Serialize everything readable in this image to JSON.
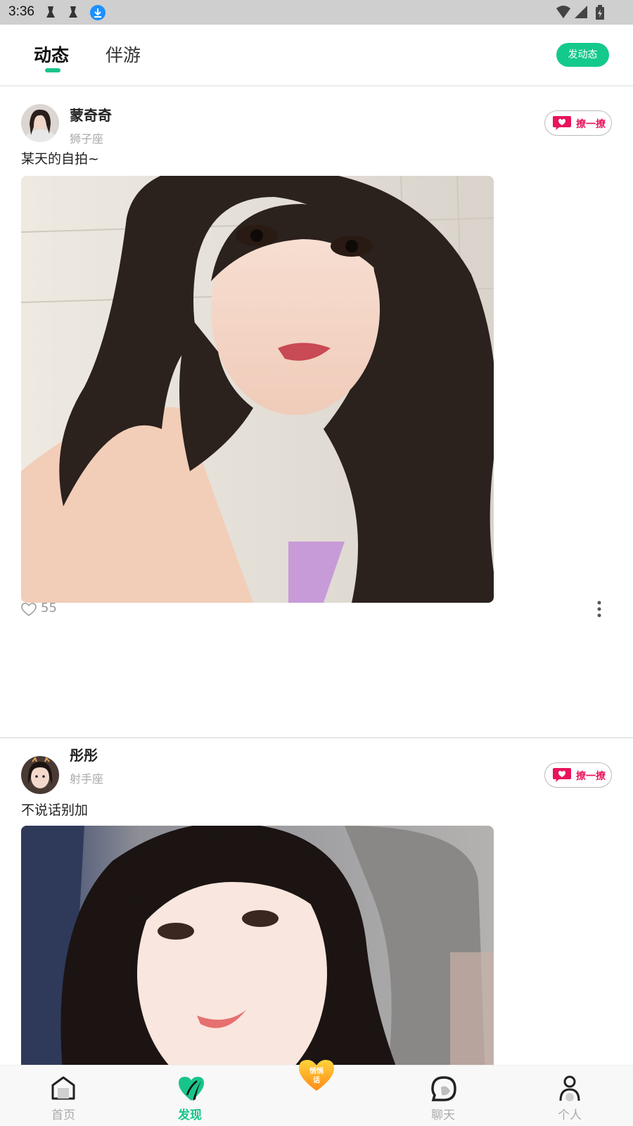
{
  "status_bar": {
    "time": "3:36"
  },
  "header": {
    "tabs": [
      {
        "label": "动态",
        "active": true
      },
      {
        "label": "伴游",
        "active": false
      }
    ],
    "post_button": "发动态",
    "accent_color": "#19c48a"
  },
  "posts": [
    {
      "username": "蒙奇奇",
      "zodiac": "狮子座",
      "flirt_button": "撩一撩",
      "caption": "某天的自拍~",
      "likes": "55"
    },
    {
      "username": "彤彤",
      "zodiac": "射手座",
      "flirt_button": "撩一撩",
      "caption": "不说话别加"
    }
  ],
  "bottom_nav": {
    "items": [
      {
        "label": "首页",
        "icon": "home-icon",
        "active": false
      },
      {
        "label": "发现",
        "icon": "discover-icon",
        "active": true
      },
      {
        "label": "悄悄话",
        "icon": "whisper-heart-icon",
        "active": false
      },
      {
        "label": "聊天",
        "icon": "chat-icon",
        "active": false
      },
      {
        "label": "个人",
        "icon": "profile-icon",
        "active": false
      }
    ]
  }
}
